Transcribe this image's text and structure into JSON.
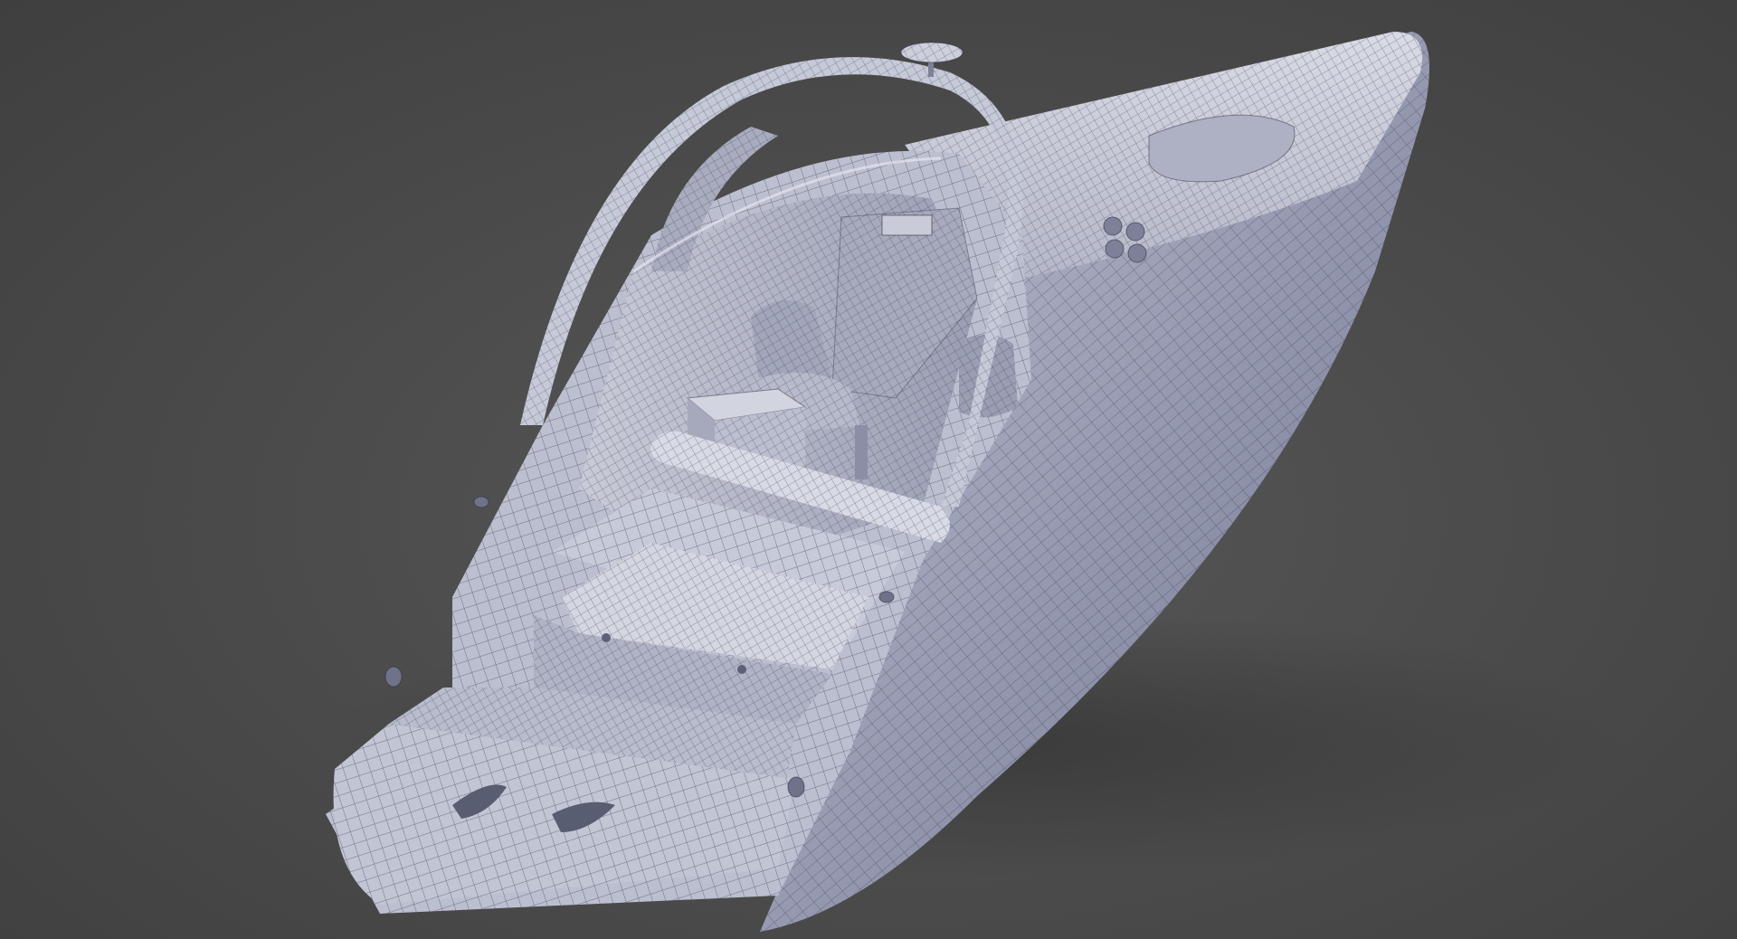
{
  "scene": {
    "subject": "boat-hull-wireframe",
    "colors": {
      "background": "#4b4b4b",
      "mesh_surface": "#b9bccf",
      "mesh_shadow": "#8b8fa6",
      "mesh_highlight": "#dfe1ea",
      "wire_lines": "#2e3040"
    }
  }
}
